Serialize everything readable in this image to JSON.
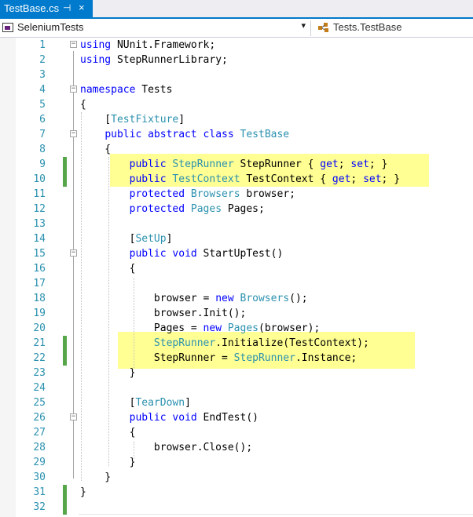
{
  "tab": {
    "title": "TestBase.cs",
    "pin_glyph": "⊣",
    "close_glyph": "×"
  },
  "navbar": {
    "project": "SeleniumTests",
    "dropdown_glyph": "▾",
    "member": "Tests.TestBase"
  },
  "colors": {
    "keyword": "#0000ff",
    "type": "#2b91af",
    "line_number": "#2b91af",
    "highlight": "#ffff80",
    "change_marker": "#57a64a",
    "tab_accent": "#007acc"
  },
  "code_lines": [
    {
      "n": "1",
      "t": [
        {
          "k": "kw",
          "s": "using"
        },
        {
          "s": " NUnit.Framework;"
        }
      ]
    },
    {
      "n": "2",
      "t": [
        {
          "k": "kw",
          "s": "using"
        },
        {
          "s": " StepRunnerLibrary;"
        }
      ]
    },
    {
      "n": "3",
      "t": []
    },
    {
      "n": "4",
      "t": [
        {
          "k": "kw",
          "s": "namespace"
        },
        {
          "s": " Tests"
        }
      ]
    },
    {
      "n": "5",
      "t": [
        {
          "s": "{"
        }
      ]
    },
    {
      "n": "6",
      "t": [
        {
          "s": "    ["
        },
        {
          "k": "ty",
          "s": "TestFixture"
        },
        {
          "s": "]"
        }
      ]
    },
    {
      "n": "7",
      "t": [
        {
          "s": "    "
        },
        {
          "k": "kw",
          "s": "public abstract class"
        },
        {
          "s": " "
        },
        {
          "k": "ty",
          "s": "TestBase"
        }
      ]
    },
    {
      "n": "8",
      "t": [
        {
          "s": "    {"
        }
      ]
    },
    {
      "n": "9",
      "t": [
        {
          "s": "        "
        },
        {
          "k": "kw",
          "s": "public"
        },
        {
          "s": " "
        },
        {
          "k": "ty",
          "s": "StepRunner"
        },
        {
          "s": " StepRunner { "
        },
        {
          "k": "kw",
          "s": "get"
        },
        {
          "s": "; "
        },
        {
          "k": "kw",
          "s": "set"
        },
        {
          "s": "; }"
        }
      ]
    },
    {
      "n": "10",
      "t": [
        {
          "s": "        "
        },
        {
          "k": "kw",
          "s": "public"
        },
        {
          "s": " "
        },
        {
          "k": "ty",
          "s": "TestContext"
        },
        {
          "s": " TestContext { "
        },
        {
          "k": "kw",
          "s": "get"
        },
        {
          "s": "; "
        },
        {
          "k": "kw",
          "s": "set"
        },
        {
          "s": "; }"
        }
      ]
    },
    {
      "n": "11",
      "t": [
        {
          "s": "        "
        },
        {
          "k": "kw",
          "s": "protected"
        },
        {
          "s": " "
        },
        {
          "k": "ty",
          "s": "Browsers"
        },
        {
          "s": " browser;"
        }
      ]
    },
    {
      "n": "12",
      "t": [
        {
          "s": "        "
        },
        {
          "k": "kw",
          "s": "protected"
        },
        {
          "s": " "
        },
        {
          "k": "ty",
          "s": "Pages"
        },
        {
          "s": " Pages;"
        }
      ]
    },
    {
      "n": "13",
      "t": []
    },
    {
      "n": "14",
      "t": [
        {
          "s": "        ["
        },
        {
          "k": "ty",
          "s": "SetUp"
        },
        {
          "s": "]"
        }
      ]
    },
    {
      "n": "15",
      "t": [
        {
          "s": "        "
        },
        {
          "k": "kw",
          "s": "public void"
        },
        {
          "s": " StartUpTest()"
        }
      ]
    },
    {
      "n": "16",
      "t": [
        {
          "s": "        {"
        }
      ]
    },
    {
      "n": "17",
      "t": []
    },
    {
      "n": "18",
      "t": [
        {
          "s": "            browser = "
        },
        {
          "k": "kw",
          "s": "new"
        },
        {
          "s": " "
        },
        {
          "k": "ty",
          "s": "Browsers"
        },
        {
          "s": "();"
        }
      ]
    },
    {
      "n": "19",
      "t": [
        {
          "s": "            browser.Init();"
        }
      ]
    },
    {
      "n": "20",
      "t": [
        {
          "s": "            Pages = "
        },
        {
          "k": "kw",
          "s": "new"
        },
        {
          "s": " "
        },
        {
          "k": "ty",
          "s": "Pages"
        },
        {
          "s": "(browser);"
        }
      ]
    },
    {
      "n": "21",
      "t": [
        {
          "s": "            "
        },
        {
          "k": "ty",
          "s": "StepRunner"
        },
        {
          "s": ".Initialize(TestContext);"
        }
      ]
    },
    {
      "n": "22",
      "t": [
        {
          "s": "            StepRunner = "
        },
        {
          "k": "ty",
          "s": "StepRunner"
        },
        {
          "s": ".Instance;"
        }
      ]
    },
    {
      "n": "23",
      "t": [
        {
          "s": "        }"
        }
      ]
    },
    {
      "n": "24",
      "t": []
    },
    {
      "n": "25",
      "t": [
        {
          "s": "        ["
        },
        {
          "k": "ty",
          "s": "TearDown"
        },
        {
          "s": "]"
        }
      ]
    },
    {
      "n": "26",
      "t": [
        {
          "s": "        "
        },
        {
          "k": "kw",
          "s": "public void"
        },
        {
          "s": " EndTest()"
        }
      ]
    },
    {
      "n": "27",
      "t": [
        {
          "s": "        {"
        }
      ]
    },
    {
      "n": "28",
      "t": [
        {
          "s": "            browser.Close();"
        }
      ]
    },
    {
      "n": "29",
      "t": [
        {
          "s": "        }"
        }
      ]
    },
    {
      "n": "30",
      "t": [
        {
          "s": "    }"
        }
      ]
    },
    {
      "n": "31",
      "t": [
        {
          "s": "}"
        }
      ]
    },
    {
      "n": "32",
      "t": []
    }
  ]
}
